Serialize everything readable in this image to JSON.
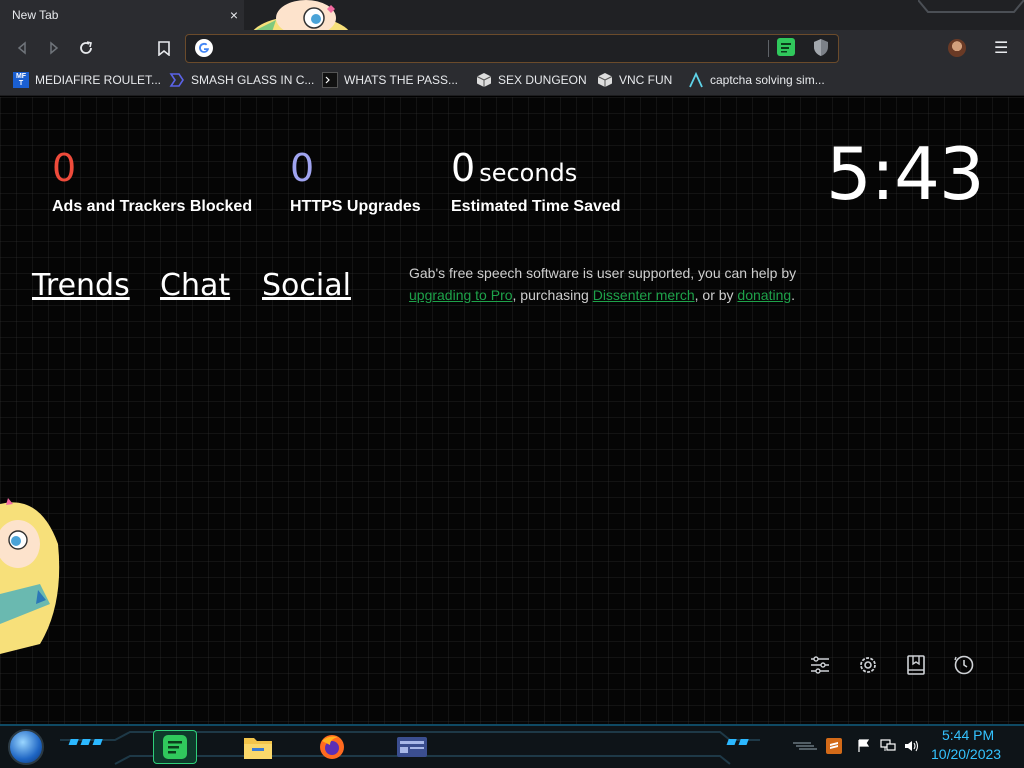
{
  "browser": {
    "tab_title": "New Tab",
    "tab_close": "×",
    "omnibox_placeholder": "",
    "menu_glyph": "☰",
    "icons": {
      "back": "back-arrow-icon",
      "forward": "forward-arrow-icon",
      "reload": "reload-icon",
      "bookmark": "bookmark-icon",
      "search_engine": "google-icon",
      "extension_gab": "dissenter-extension-icon",
      "extension_shield": "shield-extension-icon",
      "profile": "profile-avatar-icon",
      "menu": "menu-icon"
    }
  },
  "bookmarks": [
    {
      "label": "MEDIAFIRE ROULET...",
      "icon": "mediafire-icon"
    },
    {
      "label": "SMASH GLASS IN C...",
      "icon": "chevron-bookmark-icon"
    },
    {
      "label": "WHATS THE PASS...",
      "icon": "terminal-icon"
    },
    {
      "label": "SEX DUNGEON",
      "icon": "cube-icon"
    },
    {
      "label": "VNC FUN",
      "icon": "cube-icon"
    },
    {
      "label": "captcha solving sim...",
      "icon": "lambda-icon"
    }
  ],
  "stats": {
    "ads_blocked": {
      "value": "0",
      "label": "Ads and Trackers Blocked",
      "color": "#ef4b3b"
    },
    "https_upgrades": {
      "value": "0",
      "label": "HTTPS Upgrades",
      "color": "#a0a4f0"
    },
    "time_saved": {
      "value": "0",
      "unit": "seconds",
      "label": "Estimated Time Saved",
      "color": "#ffffff"
    }
  },
  "clock": "5:43",
  "nav_links": [
    "Trends",
    "Chat",
    "Social"
  ],
  "support": {
    "text1": "Gab's free speech software is user supported, you can help by ",
    "link1": "upgrading to Pro",
    "text2": ", purchasing ",
    "link2": "Dissenter merch",
    "text3": ", or by ",
    "link3": "donating",
    "text4": ".",
    "link_color": "#1ea24a"
  },
  "page_icons": [
    "customize-sliders-icon",
    "settings-gear-icon",
    "bookmarks-icon",
    "history-icon"
  ],
  "taskbar": {
    "apps": [
      "dissenter-app-icon",
      "file-explorer-icon",
      "firefox-icon",
      "remote-desktop-icon"
    ],
    "time": "5:44 PM",
    "date": "10/20/2023",
    "tray": [
      "sublime-text-icon",
      "flag-icon",
      "network-icon",
      "volume-icon"
    ]
  }
}
